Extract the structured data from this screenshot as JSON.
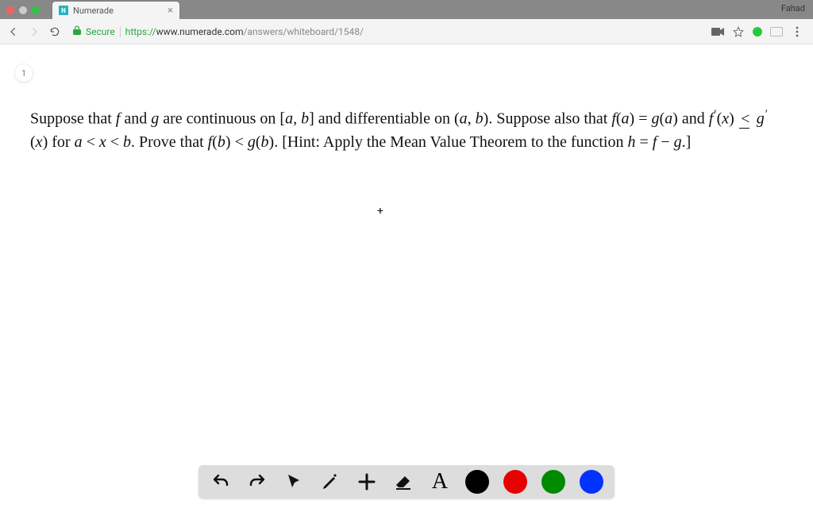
{
  "browser": {
    "profile_name": "Fahad",
    "tab": {
      "title": "Numerade",
      "favicon_letter": "N"
    },
    "nav": {
      "back": "←",
      "forward": "→",
      "reload": "↻"
    },
    "url": {
      "secure_label": "Secure",
      "protocol": "https://",
      "host": "www.numerade.com",
      "path": "/answers/whiteboard/1548/"
    },
    "right_icons": {
      "camera": "🎥",
      "star": "☆",
      "more": "⋮"
    }
  },
  "slide": {
    "number": "1"
  },
  "problem": {
    "text_parts": {
      "p1": "Suppose that ",
      "f": "f",
      "and1": " and ",
      "g": "g",
      "p2": " are continuous on [",
      "a": "a",
      "comma1": ", ",
      "b": "b",
      "p3": "] and differentiable on (",
      "comma2": ", ",
      "p4": "). Suppose also that ",
      "fa": "f",
      "lpar1": "(",
      "rpar1": ") = ",
      "ga": "g",
      "lpar2": "(",
      "rpar2": ") and ",
      "fprime": "f",
      "prime_sym": "′",
      "x": "x",
      "leq": "<",
      "gprime": "g",
      "for": " for ",
      "lt": " < ",
      "p5": ". Prove that ",
      "fb": "f",
      "ltmid": " < ",
      "gb": "g",
      "p6": ". [Hint: Apply the Mean Value Theorem to the function ",
      "h": "h",
      "eq": " = ",
      "minus": " − ",
      "p7": ".]"
    }
  },
  "cursor": {
    "plus": "+"
  },
  "toolbar": {
    "undo": "undo",
    "redo": "redo",
    "pointer": "pointer",
    "pencil": "pencil",
    "add": "add",
    "eraser": "eraser",
    "text_label": "A",
    "colors": {
      "black": "#000000",
      "red": "#e60000",
      "green": "#008a00",
      "blue": "#0033ff"
    }
  }
}
